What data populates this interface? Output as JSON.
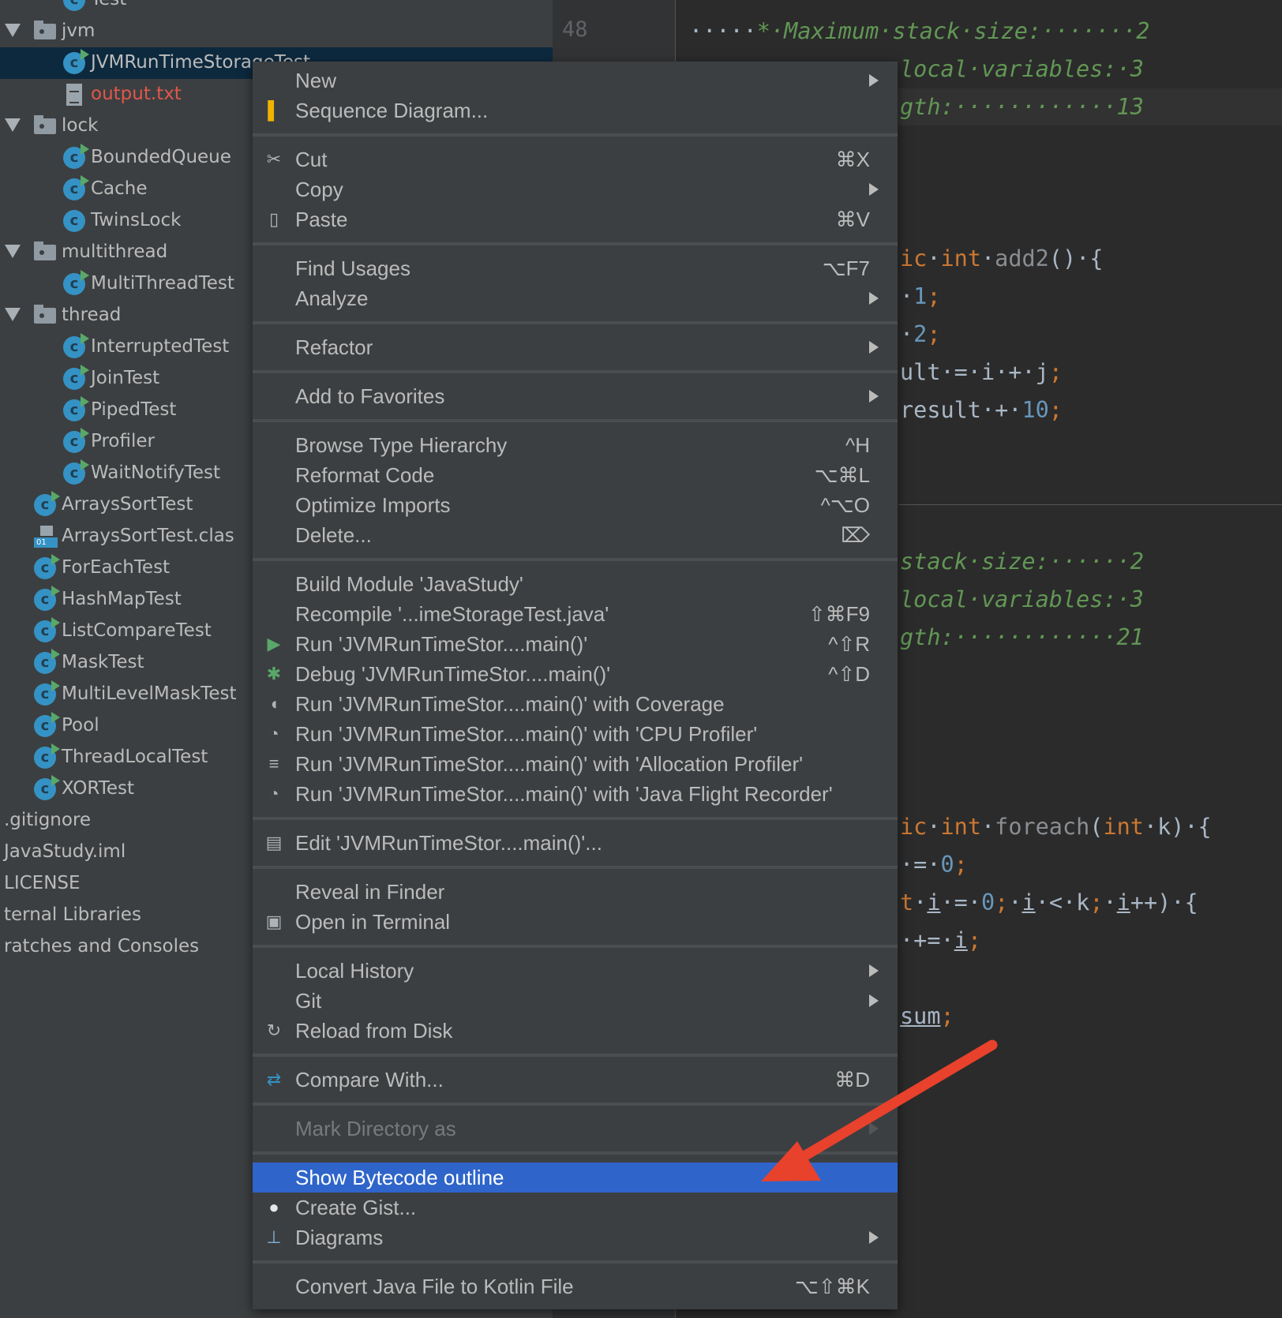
{
  "colors": {
    "accent": "#2f65ca",
    "arrow": "#e8412c",
    "selection": "#0d293e"
  },
  "tree": [
    {
      "label": "Test",
      "type": "class",
      "level": 2,
      "run": true
    },
    {
      "label": "jvm",
      "type": "folder",
      "level": 1,
      "expanded": true
    },
    {
      "label": "JVMRunTimeStorageTest",
      "type": "class",
      "level": 2,
      "run": true,
      "selected": true
    },
    {
      "label": "output.txt",
      "type": "text",
      "level": 2,
      "modified": true
    },
    {
      "label": "lock",
      "type": "folder",
      "level": 1,
      "expanded": true
    },
    {
      "label": "BoundedQueue",
      "type": "class",
      "level": 2,
      "run": true
    },
    {
      "label": "Cache",
      "type": "class",
      "level": 2,
      "run": true
    },
    {
      "label": "TwinsLock",
      "type": "class",
      "level": 2,
      "run": false
    },
    {
      "label": "multithread",
      "type": "folder",
      "level": 1,
      "expanded": true
    },
    {
      "label": "MultiThreadTest",
      "type": "class",
      "level": 2,
      "run": true
    },
    {
      "label": "thread",
      "type": "folder",
      "level": 1,
      "expanded": true
    },
    {
      "label": "InterruptedTest",
      "type": "class",
      "level": 2,
      "run": true
    },
    {
      "label": "JoinTest",
      "type": "class",
      "level": 2,
      "run": true
    },
    {
      "label": "PipedTest",
      "type": "class",
      "level": 2,
      "run": true
    },
    {
      "label": "Profiler",
      "type": "class",
      "level": 2,
      "run": true
    },
    {
      "label": "WaitNotifyTest",
      "type": "class",
      "level": 2,
      "run": true
    },
    {
      "label": "ArraysSortTest",
      "type": "class",
      "level": 1,
      "run": true
    },
    {
      "label": "ArraysSortTest.clas",
      "type": "classfile",
      "level": 1
    },
    {
      "label": "ForEachTest",
      "type": "class",
      "level": 1,
      "run": true
    },
    {
      "label": "HashMapTest",
      "type": "class",
      "level": 1,
      "run": true
    },
    {
      "label": "ListCompareTest",
      "type": "class",
      "level": 1,
      "run": true
    },
    {
      "label": "MaskTest",
      "type": "class",
      "level": 1,
      "run": true
    },
    {
      "label": "MultiLevelMaskTest",
      "type": "class",
      "level": 1,
      "run": true
    },
    {
      "label": "Pool",
      "type": "class",
      "level": 1,
      "run": true
    },
    {
      "label": "ThreadLocalTest",
      "type": "class",
      "level": 1,
      "run": true
    },
    {
      "label": "XORTest",
      "type": "class",
      "level": 1,
      "run": true
    },
    {
      "label": ".gitignore",
      "type": "plain",
      "level": 0
    },
    {
      "label": "JavaStudy.iml",
      "type": "plain",
      "level": 0
    },
    {
      "label": "LICENSE",
      "type": "plain",
      "level": 0
    },
    {
      "label": "ternal Libraries",
      "type": "plain",
      "level": 0
    },
    {
      "label": "ratches and Consoles",
      "type": "plain",
      "level": 0
    }
  ],
  "gutter": {
    "line_number": "48"
  },
  "code": [
    {
      "row": 0,
      "full": true,
      "segs": [
        [
          "·····",
          "text"
        ],
        [
          "*·Maximum·stack·size:·······2",
          "comment"
        ]
      ]
    },
    {
      "row": 1,
      "segs": [
        [
          "local·variables:·3",
          "comment"
        ]
      ]
    },
    {
      "row": 2,
      "current": true,
      "segs": [
        [
          "gth:············13",
          "comment"
        ]
      ]
    },
    {
      "row": 6,
      "segs": [
        [
          "ic",
          "kw"
        ],
        [
          "·",
          "text"
        ],
        [
          "int",
          "kw"
        ],
        [
          "·",
          "text"
        ],
        [
          "add2",
          "unused"
        ],
        [
          "()·{",
          "text"
        ]
      ]
    },
    {
      "row": 7,
      "segs": [
        [
          "·",
          "text"
        ],
        [
          "1",
          "num"
        ],
        [
          ";",
          "kw"
        ]
      ]
    },
    {
      "row": 8,
      "segs": [
        [
          "·",
          "text"
        ],
        [
          "2",
          "num"
        ],
        [
          ";",
          "kw"
        ]
      ]
    },
    {
      "row": 9,
      "segs": [
        [
          "ult·=·i·+·j",
          "text"
        ],
        [
          ";",
          "kw"
        ]
      ]
    },
    {
      "row": 10,
      "segs": [
        [
          "result·+·",
          "text"
        ],
        [
          "10",
          "num"
        ],
        [
          ";",
          "kw"
        ]
      ]
    },
    {
      "row": 14,
      "segs": [
        [
          "stack·size:······2",
          "comment"
        ]
      ]
    },
    {
      "row": 15,
      "segs": [
        [
          "local·variables:·3",
          "comment"
        ]
      ]
    },
    {
      "row": 16,
      "segs": [
        [
          "gth:············21",
          "comment"
        ]
      ]
    },
    {
      "row": 21,
      "segs": [
        [
          "ic",
          "kw"
        ],
        [
          "·",
          "text"
        ],
        [
          "int",
          "kw"
        ],
        [
          "·",
          "text"
        ],
        [
          "foreach",
          "unused"
        ],
        [
          "(",
          "text"
        ],
        [
          "int",
          "kw"
        ],
        [
          "·k)·{",
          "text"
        ]
      ]
    },
    {
      "row": 22,
      "segs": [
        [
          "·=·",
          "text"
        ],
        [
          "0",
          "num"
        ],
        [
          ";",
          "kw"
        ]
      ]
    },
    {
      "row": 23,
      "segs": [
        [
          "t",
          "kw"
        ],
        [
          "·",
          "text"
        ],
        [
          "i",
          "ul"
        ],
        [
          "·=·",
          "text"
        ],
        [
          "0",
          "num"
        ],
        [
          ";",
          "kw"
        ],
        [
          "·",
          "text"
        ],
        [
          "i",
          "ul"
        ],
        [
          "·<·k",
          "text"
        ],
        [
          ";",
          "kw"
        ],
        [
          "·",
          "text"
        ],
        [
          "i",
          "ul"
        ],
        [
          "++)·{",
          "text"
        ]
      ]
    },
    {
      "row": 24,
      "segs": [
        [
          "·+=·",
          "text"
        ],
        [
          "i",
          "ul"
        ],
        [
          ";",
          "kw"
        ]
      ]
    },
    {
      "row": 26,
      "segs": [
        [
          "sum",
          "ul"
        ],
        [
          ";",
          "kw"
        ]
      ]
    }
  ],
  "menu": [
    {
      "label": "New",
      "submenu": true
    },
    {
      "label": "Sequence Diagram...",
      "icon": "sequence-diagram-icon"
    },
    {
      "sep": true
    },
    {
      "label": "Cut",
      "shortcut": "⌘X",
      "icon": "scissors-icon"
    },
    {
      "label": "Copy",
      "submenu": true
    },
    {
      "label": "Paste",
      "shortcut": "⌘V",
      "icon": "clipboard-icon"
    },
    {
      "sep": true
    },
    {
      "label": "Find Usages",
      "shortcut": "⌥F7"
    },
    {
      "label": "Analyze",
      "submenu": true
    },
    {
      "sep": true
    },
    {
      "label": "Refactor",
      "submenu": true
    },
    {
      "sep": true
    },
    {
      "label": "Add to Favorites",
      "submenu": true
    },
    {
      "sep": true
    },
    {
      "label": "Browse Type Hierarchy",
      "shortcut": "^H"
    },
    {
      "label": "Reformat Code",
      "shortcut": "⌥⌘L"
    },
    {
      "label": "Optimize Imports",
      "shortcut": "^⌥O"
    },
    {
      "label": "Delete...",
      "shortcut": "⌦"
    },
    {
      "sep": true
    },
    {
      "label": "Build Module 'JavaStudy'"
    },
    {
      "label": "Recompile '...imeStorageTest.java'",
      "shortcut": "⇧⌘F9"
    },
    {
      "label": "Run 'JVMRunTimeStor....main()'",
      "shortcut": "^⇧R",
      "icon": "run-icon"
    },
    {
      "label": "Debug 'JVMRunTimeStor....main()'",
      "shortcut": "^⇧D",
      "icon": "debug-icon"
    },
    {
      "label": "Run 'JVMRunTimeStor....main()' with Coverage",
      "icon": "coverage-icon"
    },
    {
      "label": "Run 'JVMRunTimeStor....main()' with 'CPU Profiler'",
      "icon": "cpu-profiler-icon"
    },
    {
      "label": "Run 'JVMRunTimeStor....main()' with 'Allocation Profiler'",
      "icon": "allocation-profiler-icon"
    },
    {
      "label": "Run 'JVMRunTimeStor....main()' with 'Java Flight Recorder'",
      "icon": "flight-recorder-icon"
    },
    {
      "sep": true
    },
    {
      "label": "Edit 'JVMRunTimeStor....main()'...",
      "icon": "edit-config-icon"
    },
    {
      "sep": true
    },
    {
      "label": "Reveal in Finder"
    },
    {
      "label": "Open in Terminal",
      "icon": "terminal-icon"
    },
    {
      "sep": true
    },
    {
      "label": "Local History",
      "submenu": true
    },
    {
      "label": "Git",
      "submenu": true
    },
    {
      "label": "Reload from Disk",
      "icon": "reload-icon"
    },
    {
      "sep": true
    },
    {
      "label": "Compare With...",
      "shortcut": "⌘D",
      "icon": "compare-icon"
    },
    {
      "sep": true
    },
    {
      "label": "Mark Directory as",
      "submenu": true,
      "disabled": true
    },
    {
      "sep": true
    },
    {
      "label": "Show Bytecode outline",
      "highlighted": true
    },
    {
      "label": "Create Gist...",
      "icon": "github-icon"
    },
    {
      "label": "Diagrams",
      "submenu": true,
      "icon": "diagrams-icon"
    },
    {
      "sep": true
    },
    {
      "label": "Convert Java File to Kotlin File",
      "shortcut": "⌥⇧⌘K"
    }
  ]
}
